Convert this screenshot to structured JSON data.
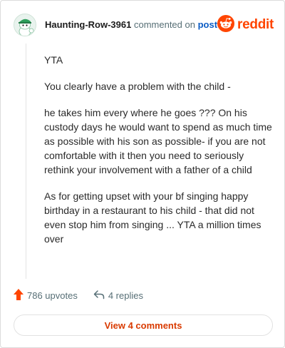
{
  "header": {
    "username": "Haunting-Row-3961",
    "commented_text": "commented on",
    "post_link": "post",
    "brand_wordmark": "reddit",
    "avatar_icon": "snoo-avatar-icon",
    "logo_icon": "reddit-logo-icon"
  },
  "comment": {
    "paragraphs": [
      "YTA",
      "You clearly have a problem with the child -",
      "he takes him every where he goes ??? On his custody days he would want to spend as much time as possible with his son as possible- if you are not comfortable with it then you need to seriously rethink your involvement with a father of a child",
      "As for getting upset with your bf singing happy birthday in a restaurant to his child - that did not even stop him from singing ... YTA a million times over"
    ]
  },
  "actions": {
    "upvotes": "786 upvotes",
    "replies": "4 replies",
    "upvote_icon": "upvote-arrow-icon",
    "reply_icon": "reply-arrow-icon"
  },
  "view_comments": "View 4 comments",
  "colors": {
    "accent": "#ff4500",
    "link": "#0a5bc4",
    "view_button_text": "#d93a00",
    "muted": "#576f76"
  }
}
